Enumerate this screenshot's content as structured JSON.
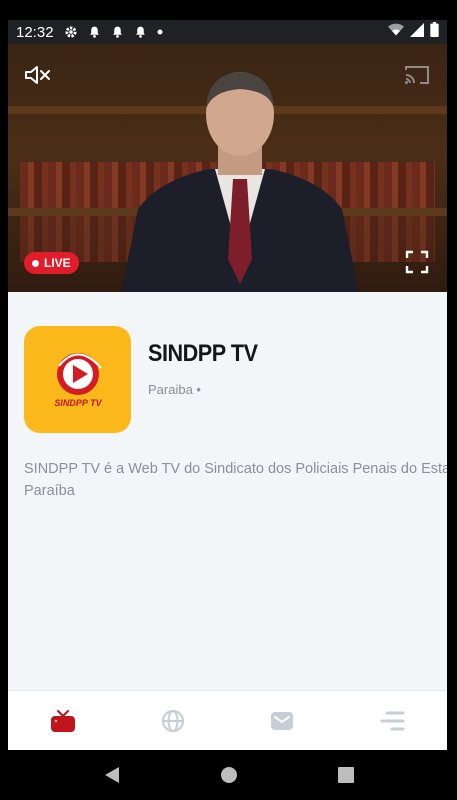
{
  "status_bar": {
    "time": "12:32",
    "left_icons": [
      "gear-icon",
      "bell-icon",
      "bell-icon",
      "bell-icon",
      "dot-icon"
    ],
    "right_icons": [
      "wifi-icon",
      "signal-icon",
      "battery-icon"
    ]
  },
  "video": {
    "mute_icon": "volume-mute-icon",
    "cast_icon": "cast-icon",
    "live_label": "LIVE",
    "fullscreen_icon": "fullscreen-icon"
  },
  "channel": {
    "logo_text": "SINDPP TV",
    "title": "SINDPP TV",
    "subtitle": "Paraiba •",
    "description": "SINDPP TV é a Web TV do Sindicato dos Policiais Penais do Estado da Paraíba"
  },
  "bottom_nav": {
    "items": [
      {
        "icon": "tv-icon",
        "active": true
      },
      {
        "icon": "globe-icon",
        "active": false
      },
      {
        "icon": "mail-icon",
        "active": false
      },
      {
        "icon": "menu-icon",
        "active": false
      }
    ]
  },
  "colors": {
    "accent": "#c0151c",
    "live": "#e11d2a",
    "logo_bg": "#fbb81a",
    "inactive_icon": "#c7ced6"
  },
  "system_nav": {
    "buttons": [
      "back-icon",
      "home-icon",
      "recents-icon"
    ]
  }
}
